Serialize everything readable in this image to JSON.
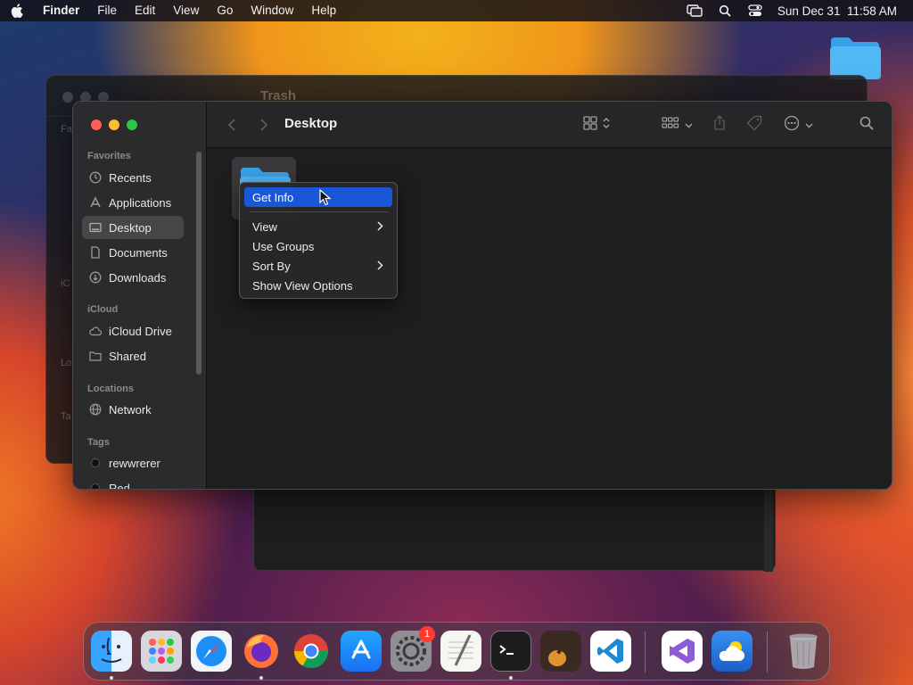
{
  "menubar": {
    "app_name": "Finder",
    "items": [
      "File",
      "Edit",
      "View",
      "Go",
      "Window",
      "Help"
    ],
    "clock": "Sun Dec 31  11:58 AM"
  },
  "bg_window": {
    "title": "Trash",
    "sidebar_labels": [
      "Fa",
      "iC",
      "Lo",
      "Ta"
    ]
  },
  "finder": {
    "title": "Desktop",
    "sidebar": {
      "favorites_label": "Favorites",
      "favorites": [
        {
          "label": "Recents",
          "icon": "clock-icon"
        },
        {
          "label": "Applications",
          "icon": "applications-icon"
        },
        {
          "label": "Desktop",
          "icon": "desktop-icon",
          "selected": true
        },
        {
          "label": "Documents",
          "icon": "document-icon"
        },
        {
          "label": "Downloads",
          "icon": "download-icon"
        }
      ],
      "icloud_label": "iCloud",
      "icloud": [
        {
          "label": "iCloud Drive",
          "icon": "cloud-icon"
        },
        {
          "label": "Shared",
          "icon": "shared-folder-icon"
        }
      ],
      "locations_label": "Locations",
      "locations": [
        {
          "label": "Network",
          "icon": "globe-icon"
        }
      ],
      "tags_label": "Tags",
      "tags": [
        {
          "label": "rewwrerer",
          "color": "#111111"
        },
        {
          "label": "Red",
          "color": "#111111"
        }
      ]
    }
  },
  "context_menu": {
    "items": [
      {
        "label": "Get Info",
        "active": true,
        "submenu": false
      },
      {
        "label": "View",
        "active": false,
        "submenu": true
      },
      {
        "label": "Use Groups",
        "active": false,
        "submenu": false
      },
      {
        "label": "Sort By",
        "active": false,
        "submenu": true
      },
      {
        "label": "Show View Options",
        "active": false,
        "submenu": false
      }
    ]
  },
  "dock": {
    "apps": [
      "Finder",
      "Launchpad",
      "Safari",
      "Firefox",
      "Chrome",
      "App Store",
      "System Settings",
      "TextEdit",
      "Terminal",
      "GarageBand",
      "Visual Studio Code",
      "Visual Studio",
      "Weather",
      "Trash"
    ],
    "settings_badge": "1"
  },
  "colors": {
    "accent": "#1a57d6",
    "close": "#ff5f57",
    "minimize": "#febc2e",
    "zoom": "#28c840"
  }
}
